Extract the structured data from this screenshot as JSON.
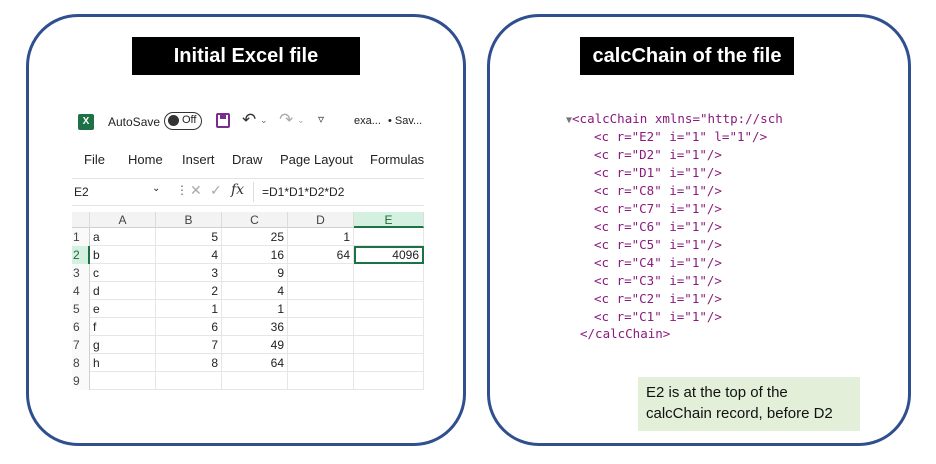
{
  "left_title": "Initial Excel file",
  "right_title": "calcChain of the file",
  "excel": {
    "autosave_label": "AutoSave",
    "toggle_state": "Off",
    "filename": "exa...",
    "saved_status": "• Sav...",
    "menu": [
      "File",
      "Home",
      "Insert",
      "Draw",
      "Page Layout",
      "Formulas"
    ],
    "name_box": "E2",
    "fx_label": "fx",
    "formula": "=D1*D1*D2*D2",
    "columns": [
      "A",
      "B",
      "C",
      "D",
      "E"
    ],
    "rows": [
      {
        "n": "1",
        "A": "a",
        "B": "5",
        "C": "25",
        "D": "1",
        "E": ""
      },
      {
        "n": "2",
        "A": "b",
        "B": "4",
        "C": "16",
        "D": "64",
        "E": "4096"
      },
      {
        "n": "3",
        "A": "c",
        "B": "3",
        "C": "9",
        "D": "",
        "E": ""
      },
      {
        "n": "4",
        "A": "d",
        "B": "2",
        "C": "4",
        "D": "",
        "E": ""
      },
      {
        "n": "5",
        "A": "e",
        "B": "1",
        "C": "1",
        "D": "",
        "E": ""
      },
      {
        "n": "6",
        "A": "f",
        "B": "6",
        "C": "36",
        "D": "",
        "E": ""
      },
      {
        "n": "7",
        "A": "g",
        "B": "7",
        "C": "49",
        "D": "",
        "E": ""
      },
      {
        "n": "8",
        "A": "h",
        "B": "8",
        "C": "64",
        "D": "",
        "E": ""
      },
      {
        "n": "9",
        "A": "",
        "B": "",
        "C": "",
        "D": "",
        "E": ""
      }
    ],
    "selected_cell": "E2"
  },
  "calcchain": {
    "open_tag": "<calcChain xmlns=\"http://sch",
    "lines": [
      "<c r=\"E2\" i=\"1\" l=\"1\"/>",
      "<c r=\"D2\" i=\"1\"/>",
      "<c r=\"D1\" i=\"1\"/>",
      "<c r=\"C8\" i=\"1\"/>",
      "<c r=\"C7\" i=\"1\"/>",
      "<c r=\"C6\" i=\"1\"/>",
      "<c r=\"C5\" i=\"1\"/>",
      "<c r=\"C4\" i=\"1\"/>",
      "<c r=\"C3\" i=\"1\"/>",
      "<c r=\"C2\" i=\"1\"/>",
      "<c r=\"C1\" i=\"1\"/>"
    ],
    "close_tag": "</calcChain>"
  },
  "note": {
    "line1": "E2 is at the top of the",
    "line2": "calcChain record, before D2"
  },
  "colors": {
    "panel_border": "#2f4f8f",
    "excel_green": "#1e7145",
    "note_bg": "#e3efd9",
    "xml_tag": "#8a1a7e",
    "xml_value": "#1a1aa6"
  }
}
